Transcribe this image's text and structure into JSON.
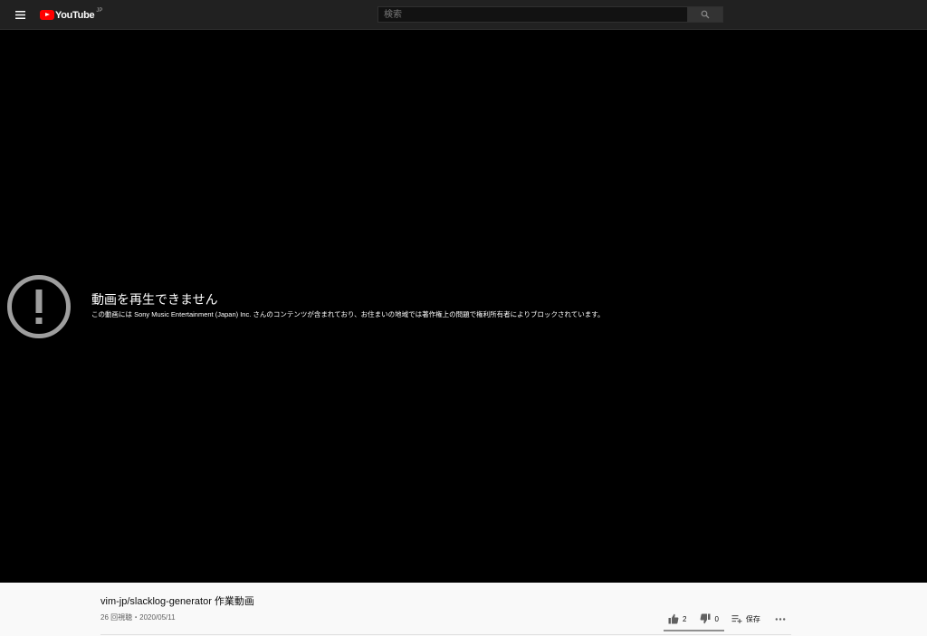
{
  "header": {
    "logo_text": "YouTube",
    "logo_region": "JP",
    "search_placeholder": "検索",
    "icons": [
      "menu-icon",
      "youtube-logo-icon",
      "search-icon"
    ]
  },
  "player": {
    "error_title": "動画を再生できません",
    "error_message": "この動画には Sony Music Entertainment (Japan) Inc. さんのコンテンツが含まれており、お住まいの地域では著作権上の問題で権利所有者によりブロックされています。",
    "icon": "alert-circle-icon"
  },
  "video": {
    "title": "vim-jp/slacklog-generator 作業動画",
    "meta": "26 回視聴・2020/05/11",
    "likes": "2",
    "dislikes": "0",
    "save_label": "保存",
    "like_ratio": 1.0
  },
  "colors": {
    "topbar": "#212121",
    "player_bg": "#000000",
    "brand_red": "#ff0000",
    "page_bg": "#f9f9f9"
  }
}
